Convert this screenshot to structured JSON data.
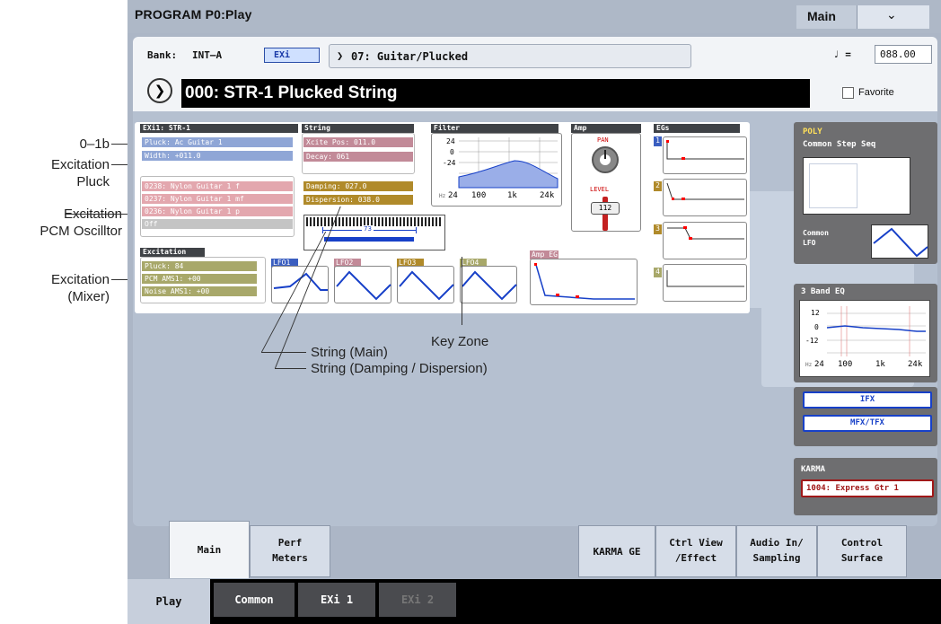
{
  "callouts": [
    {
      "text": "0–1b"
    },
    {
      "text": "Excitation\nPluck"
    },
    {
      "text": "Excitation\nPCM Oscilltor"
    },
    {
      "text": "Excitation\n(Mixer)"
    },
    {
      "text": "Key Zone"
    },
    {
      "text": "String (Main)"
    },
    {
      "text": "String (Damping / Dispersion)"
    }
  ],
  "header": {
    "title": "PROGRAM P0:Play",
    "page_label": "Main",
    "dropdown_icon": "chevron-down-icon"
  },
  "bank": {
    "label": "Bank:",
    "value": "INT–A",
    "type_badge": "EXi",
    "category": "07: Guitar/Plucked",
    "tempo_symbol": "♩ =",
    "tempo": "088.00"
  },
  "program": {
    "name": "000: STR-1 Plucked String",
    "favorite_label": "Favorite",
    "favorite_checked": false
  },
  "exi": {
    "header": "EXi1:  STR-1",
    "pluck": "Pluck: Ac Guitar 1",
    "width": "Width: +011.0",
    "pcm": [
      "0238: Nylon Guitar 1  f",
      "0237: Nylon Guitar 1 mf",
      "0236: Nylon Guitar 1  p",
      "Off"
    ]
  },
  "string": {
    "header": "String",
    "xcite": "Xcite Pos:  011.0",
    "decay": "Decay:        061",
    "damping": "Damping:   027.0",
    "dispersion": "Dispersion: 038.0",
    "keyzone": "73"
  },
  "filter": {
    "header": "Filter",
    "y_ticks": [
      "24",
      "0",
      "-24"
    ],
    "x_ticks": [
      "Hz",
      "24",
      "100",
      "1k",
      "24k"
    ]
  },
  "amp": {
    "header": "Amp",
    "pan": "PAN",
    "level": "LEVEL",
    "level_value": "112"
  },
  "egs": {
    "header": "EGs",
    "items": [
      "1",
      "2",
      "3",
      "4"
    ]
  },
  "excitation": {
    "header": "Excitation",
    "pluck": "Pluck:         84",
    "pcm": "PCM AMS1:  +00",
    "noise": "Noise AMS1:  +00"
  },
  "lfos": [
    "LFO1",
    "LFO2",
    "LFO3",
    "LFO4"
  ],
  "amp_eg": "Amp EG",
  "right": {
    "poly": "POLY",
    "step_seq": "Common Step Seq",
    "common_lfo": "Common\nLFO",
    "eq": "3 Band EQ",
    "eq_y": [
      "12",
      "0",
      "-12"
    ],
    "eq_x": [
      "Hz",
      "24",
      "100",
      "1k",
      "24k"
    ],
    "ifx": "IFX",
    "mfx": "MFX/TFX",
    "karma": "KARMA",
    "karma_value": "1004: Express Gtr 1"
  },
  "tabs": [
    {
      "label": "Main",
      "active": true
    },
    {
      "label": "Perf\nMeters"
    },
    {
      "label": "KARMA GE"
    },
    {
      "label": "Ctrl View\n/Effect"
    },
    {
      "label": "Audio In/\nSampling"
    },
    {
      "label": "Control\nSurface"
    }
  ],
  "bottom_tabs": [
    {
      "label": "Play",
      "active": true
    },
    {
      "label": "Common"
    },
    {
      "label": "EXi 1"
    },
    {
      "label": "EXi 2",
      "disabled": true
    }
  ],
  "colors": {
    "blue_bar": "#8fa6d6",
    "pink_bar": "#e3a7ae",
    "olive_bar": "#a8a86a",
    "gold_bar": "#b08a2a",
    "dark_hdr": "#3f4246",
    "accent_blue": "#1740c8",
    "karma_red": "#a01818"
  }
}
